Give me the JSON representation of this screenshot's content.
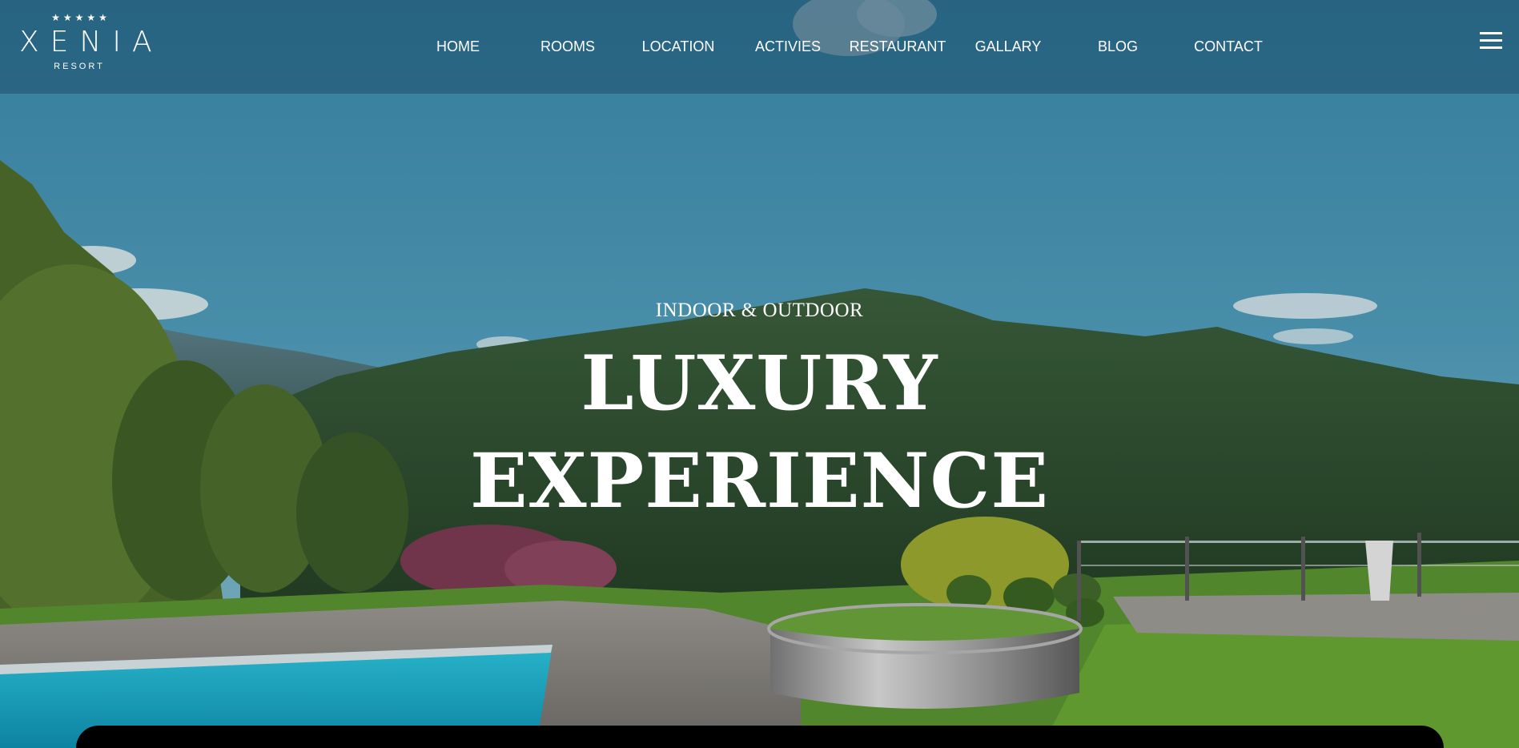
{
  "brand": {
    "stars": "★★★★★",
    "name": "XENIA",
    "subtitle": "RESORT"
  },
  "nav": {
    "items": [
      {
        "label": "HOME"
      },
      {
        "label": "ROOMS"
      },
      {
        "label": "LOCATION"
      },
      {
        "label": "ACTIVIES"
      },
      {
        "label": "RESTAURANT"
      },
      {
        "label": "GALLARY"
      },
      {
        "label": "BLOG"
      },
      {
        "label": "CONTACT"
      }
    ],
    "menu_icon": "hamburger-menu-icon"
  },
  "hero": {
    "eyebrow": "INDOOR & OUTDOOR",
    "title_line1": "LUXURY",
    "title_line2": "EXPERIENCE",
    "background": "mountain-pool-landscape-photo"
  },
  "colors": {
    "navbar": "#2f6d86",
    "sky_top": "#3f8fb0",
    "sky_bottom": "#7ab8c9",
    "mountain": "#2e5030",
    "pool": "#1fb5cf",
    "grass": "#5c9a2e",
    "deck": "#8c8a86",
    "bottom_bar": "#000000",
    "text": "#ffffff"
  }
}
